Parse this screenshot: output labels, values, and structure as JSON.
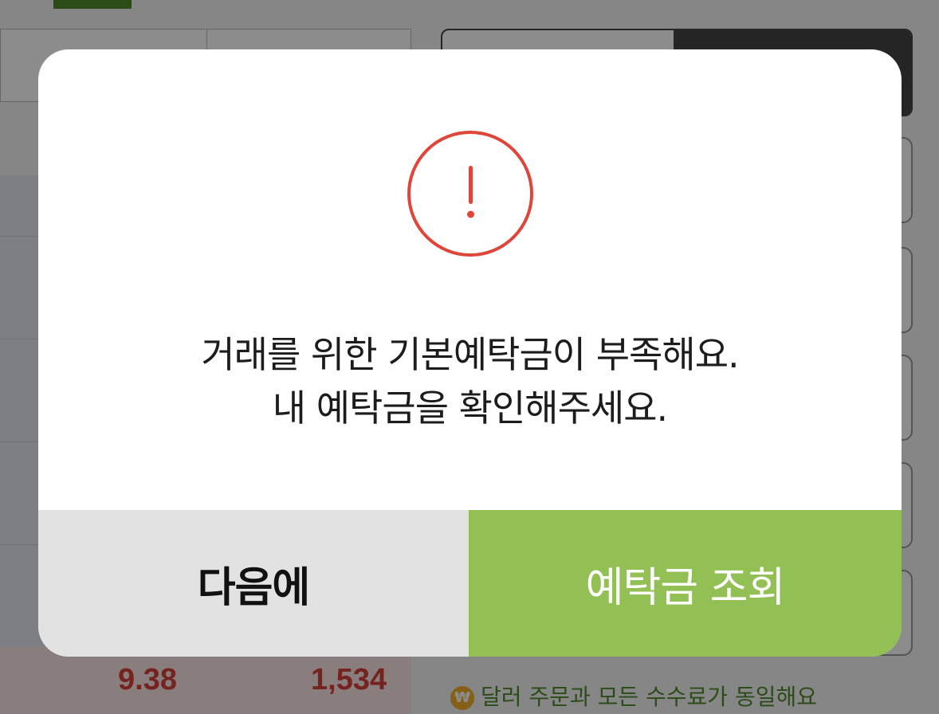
{
  "background": {
    "table_values": [
      "9.38",
      "1,534"
    ],
    "notice_icon": "won-coin-icon",
    "notice_icon_glyph": "₩",
    "notice_text": "달러 주문과 모든 수수료가 동일해요"
  },
  "dialog": {
    "icon": "exclamation-circle-icon",
    "icon_color": "#e0453a",
    "message_line1": "거래를 위한 기본예탁금이 부족해요.",
    "message_line2": "내 예탁금을 확인해주세요.",
    "buttons": {
      "later_label": "다음에",
      "deposit_label": "예탁금 조회"
    },
    "colors": {
      "primary": "#93c054",
      "secondary": "#e2e2e2"
    }
  }
}
